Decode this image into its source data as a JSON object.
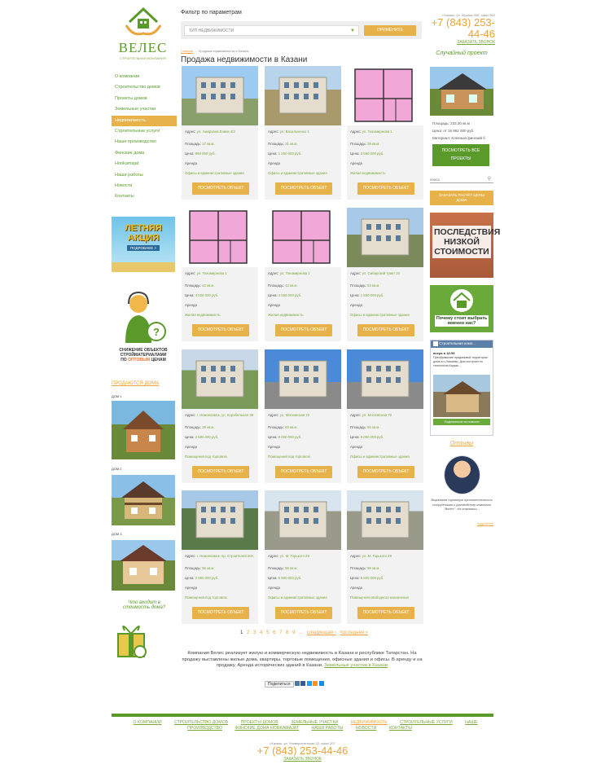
{
  "logo": {
    "name": "ВЕЛЕС",
    "subtitle": "Строительная компания"
  },
  "filter": {
    "label": "Фильтр по параметрам",
    "select_value": "ТИП НЕДВИЖИМОСТИ",
    "apply": "ПРИМЕНИТЬ"
  },
  "contact": {
    "address": "г.Казань, ул. Фучика 90б, офис 502",
    "phone": "+7 (843) 253-44-46",
    "call": "ЗАКАЗАТЬ ЗВОНОК"
  },
  "breadcrumb": {
    "home": "Главная",
    "sep": "→",
    "current": "Продажа недвижимости в Казани"
  },
  "page_title": "Продажа недвижимости в Казани",
  "nav": [
    "О компании",
    "Строительство домов",
    "Проекты домов",
    "Земельные участки",
    "Недвижимость",
    "Строительные услуги",
    "Наше производство",
    "Финские дома",
    "Honkamajat",
    "Наши работы",
    "Новости",
    "Контакты"
  ],
  "nav_active": 4,
  "labels": {
    "addr": "Адрес:",
    "area": "Площадь:",
    "price": "Цена:",
    "rent": "Аренда",
    "view": "ПОСМОТРЕТЬ ОБЪЕКТ"
  },
  "cards": [
    {
      "addr": "ул. Амирхана Еники 4/2",
      "area": "17 кв.м.",
      "price": "990 000 руб.",
      "type": "Офисы и административные здания"
    },
    {
      "addr": "ул. Васильченко 1",
      "area": "21 кв.м.",
      "price": "1 250 000 руб.",
      "type": "Офисы и административные здания"
    },
    {
      "addr": "ул. Тихомирнова 1",
      "area": "39 кв.м.",
      "price": "3 590 000 руб.",
      "type": "Жилая недвижимость"
    },
    {
      "addr": "ул. Тихомирнова 1",
      "area": "42 кв.м.",
      "price": "4 028 000 руб.",
      "type": "Жилая недвижимость"
    },
    {
      "addr": "ул. Тихомирнова 1",
      "area": "42 кв.м.",
      "price": "4 058 000 руб.",
      "type": "Жилая недвижимость"
    },
    {
      "addr": "ул. Сибирский тракт 34",
      "area": "53 кв.м.",
      "price": "1 590 000 руб.",
      "type": "Офисы и административные здания"
    },
    {
      "addr": "г. Нижнекамск, ул. Корабельная 36",
      "area": "39 кв.м.",
      "price": "2 590 000 руб.",
      "type": "Помещения под торговлю"
    },
    {
      "addr": "ул. Московская 72",
      "area": "60 кв.м.",
      "price": "9 000 000 руб.",
      "type": "Помещения под торговлю"
    },
    {
      "addr": "ул. Московская 72",
      "area": "60 кв.м.",
      "price": "9 000 000 руб.",
      "type": "Офисы и административные здания"
    },
    {
      "addr": "г. Нижнекамск, пр. Строителей 20А",
      "area": "96 кв.м.",
      "price": "2 900 000 руб.",
      "type": "Помещения под торговлю"
    },
    {
      "addr": "ул. М. Горького 29",
      "area": "96 кв.м.",
      "price": "5 800 000 руб.",
      "type": "Офисы и административные здания"
    },
    {
      "addr": "ул. М. Горького 29",
      "area": "96 кв.м.",
      "price": "5 800 000 руб.",
      "type": "Помещения свободного назначения"
    }
  ],
  "left": {
    "promo": [
      "ЛЕТНЯЯ",
      "АКЦИЯ",
      "ПОДРОБНЕЕ >"
    ],
    "discount": [
      "СНИЖЕНИЕ ОБЪЕКТОВ",
      "СТРОЙМАТЕРИАЛАМИ",
      "ПО",
      "ОПТОВЫМ",
      "ЦЕНАМ"
    ],
    "sale_title": "ПРОДАЮТСЯ ДОМА",
    "houses": [
      "ДОМ 1",
      "ДОМ 2",
      "ДОМ 3"
    ],
    "question": "Что входит в стоимость дома?"
  },
  "right": {
    "random_title": "Случайный проект",
    "area": "Площадь: 233,30 кв.м",
    "price": "Цена:     от 16 962 000 руб.",
    "material": "Материал: Клееный финский б",
    "see_all": "ПОСМОТРЕТЬ ВСЕ ПРОЕКТЫ",
    "search_ph": "поиск",
    "calc": "ЗАКАЗАТЬ РАСЧЁТ ЦЕНЫ ДОМА",
    "banner1": "ПОСЛЕДСТВИЯ НИЗКОЙ СТОИМОСТИ",
    "banner2": "Почему стоит выбрать именно нас?",
    "vk_title": "Строительная комп...",
    "vk_date": "вчера в 18:55",
    "vk_text": "Преображение придомовой территории дома в п.Лаишево. Дом построен по технологии Каркас...",
    "vk_more": "Подписаться на новости",
    "reviews": "Отзывы",
    "review_text": "Выражаем огромную признательность сотрудникам и руководству компании \"Велес\". На компании...",
    "review_more": "подробнее"
  },
  "pager": {
    "pages": [
      "1",
      "2",
      "3",
      "4",
      "5",
      "6",
      "7",
      "8",
      "9"
    ],
    "ellipsis": "...",
    "next": "следующая ›",
    "last": "последняя »"
  },
  "about": {
    "text": "Компания Велес реализует жилую и коммерческую недвижимость в Казани и республике Татарстан. На продажу выставлены жилые дома, квартиры, торговые помещения, офисные здания и офисы. В аренду и на продажу. Аренда исторических зданий в Казани.",
    "link": "Земельные участки в Казани"
  },
  "share": "Поделиться",
  "footer": {
    "nav": [
      "О компании",
      "Строительство домов",
      "Проекты домов",
      "Земельные участки",
      "Недвижимость",
      "Строительные услуги",
      "Наше производство",
      "Финские дома Honkamajat",
      "Наши работы",
      "Новости",
      "Контакты"
    ],
    "address": "г.Казань, ул. Университетская 22, офис 207",
    "phone": "+7 (843) 253-44-46",
    "call": "ЗАКАЗАТЬ ЗВОНОК"
  },
  "colors": {
    "accent": "#e8b24a",
    "green": "#5a9a2a"
  }
}
